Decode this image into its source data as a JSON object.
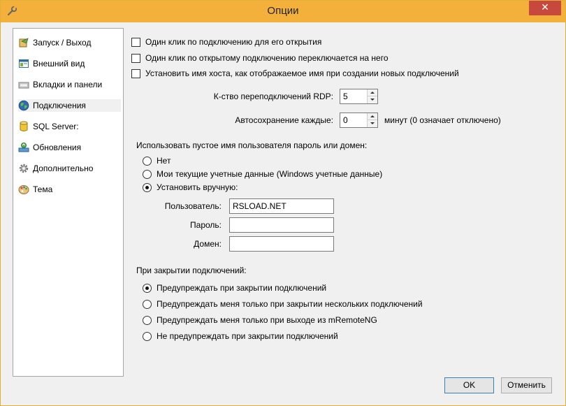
{
  "window": {
    "title": "Опции",
    "close_glyph": "✕",
    "title_icon": "wrench-icon"
  },
  "sidebar": {
    "items": [
      {
        "label": "Запуск / Выход",
        "icon": "startup-icon"
      },
      {
        "label": "Внешний вид",
        "icon": "appearance-icon"
      },
      {
        "label": "Вкладки и панели",
        "icon": "tabs-panels-icon"
      },
      {
        "label": "Подключения",
        "icon": "globe-icon",
        "selected": true
      },
      {
        "label": "SQL Server:",
        "icon": "database-icon"
      },
      {
        "label": "Обновления",
        "icon": "updates-icon"
      },
      {
        "label": "Дополнительно",
        "icon": "gear-icon"
      },
      {
        "label": "Тема",
        "icon": "palette-icon"
      }
    ]
  },
  "connections": {
    "checkboxes": [
      {
        "label": "Один клик по подключению для его открытия",
        "checked": false
      },
      {
        "label": "Один клик по открытому подключению переключается на него",
        "checked": false
      },
      {
        "label": "Установить имя хоста, как отображаемое имя при создании новых подключений",
        "checked": false
      }
    ],
    "rdp_reconnect": {
      "label": "К-ство переподключений RDP:",
      "value": "5"
    },
    "autosave": {
      "label": "Автосохранение каждые:",
      "value": "0",
      "suffix": "минут (0 означает отключено)"
    },
    "empty_credentials": {
      "heading": "Использовать пустое имя пользователя пароль или домен:",
      "options": [
        {
          "label": "Нет",
          "checked": false
        },
        {
          "label": "Мои текущие учетные данные (Windows учетные данные)",
          "checked": false
        },
        {
          "label": "Установить вручную:",
          "checked": true
        }
      ],
      "user_label": "Пользователь:",
      "user_value": "RSLOAD.NET",
      "password_label": "Пароль:",
      "password_value": "",
      "domain_label": "Домен:",
      "domain_value": ""
    },
    "on_close": {
      "heading": "При закрытии подключений:",
      "options": [
        {
          "label": "Предупреждать при закрытии подключений",
          "checked": true
        },
        {
          "label": "Предупреждать меня только при закрытии нескольких подключений",
          "checked": false
        },
        {
          "label": "Предупреждать меня только при выходе из mRemoteNG",
          "checked": false
        },
        {
          "label": "Не предупреждать при закрытии подключений",
          "checked": false
        }
      ]
    }
  },
  "buttons": {
    "ok": "OK",
    "cancel": "Отменить"
  },
  "colors": {
    "title_bar": "#f3b13c",
    "close_button": "#c7483c",
    "default_button_border": "#3c7fb1"
  }
}
